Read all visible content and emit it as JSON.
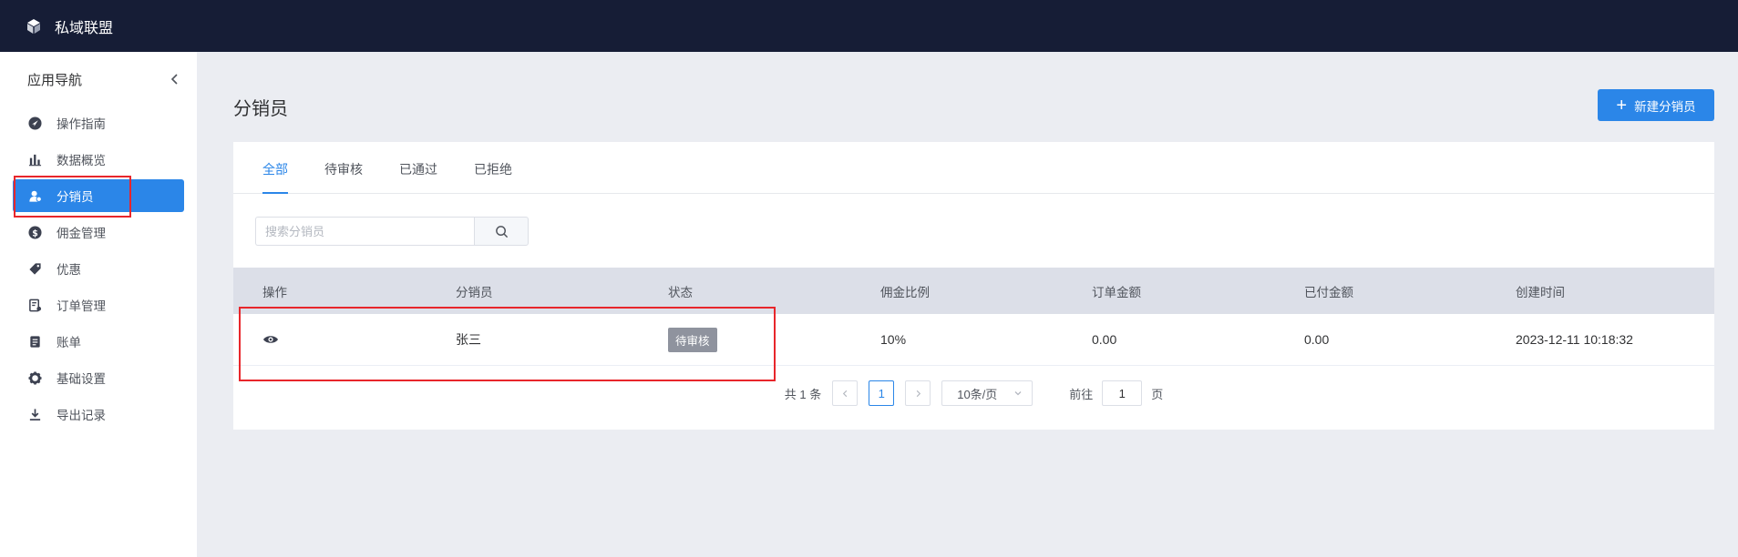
{
  "app": {
    "brand": "私域联盟"
  },
  "sidebar": {
    "title": "应用导航",
    "items": [
      {
        "label": "操作指南",
        "icon": "navigation-icon"
      },
      {
        "label": "数据概览",
        "icon": "bar-chart-icon"
      },
      {
        "label": "分销员",
        "icon": "user-group-icon",
        "active": true
      },
      {
        "label": "佣金管理",
        "icon": "dollar-icon"
      },
      {
        "label": "优惠",
        "icon": "tag-icon"
      },
      {
        "label": "订单管理",
        "icon": "order-icon"
      },
      {
        "label": "账单",
        "icon": "bill-icon"
      },
      {
        "label": "基础设置",
        "icon": "gear-icon"
      },
      {
        "label": "导出记录",
        "icon": "download-icon"
      }
    ]
  },
  "page": {
    "title": "分销员",
    "new_button": "新建分销员"
  },
  "tabs": [
    {
      "label": "全部",
      "active": true
    },
    {
      "label": "待审核"
    },
    {
      "label": "已通过"
    },
    {
      "label": "已拒绝"
    }
  ],
  "search": {
    "placeholder": "搜索分销员"
  },
  "table": {
    "columns": [
      "操作",
      "分销员",
      "状态",
      "佣金比例",
      "订单金额",
      "已付金额",
      "创建时间"
    ],
    "rows": [
      {
        "name": "张三",
        "status": "待审核",
        "commission": "10%",
        "order_amount": "0.00",
        "paid_amount": "0.00",
        "created": "2023-12-11 10:18:32"
      }
    ]
  },
  "pagination": {
    "total_text": "共 1 条",
    "current_page": "1",
    "page_size": "10条/页",
    "goto_label": "前往",
    "goto_value": "1",
    "page_suffix": "页"
  },
  "colors": {
    "accent": "#2b86e8",
    "topbar": "#161d36",
    "highlight": "#e8262b"
  }
}
